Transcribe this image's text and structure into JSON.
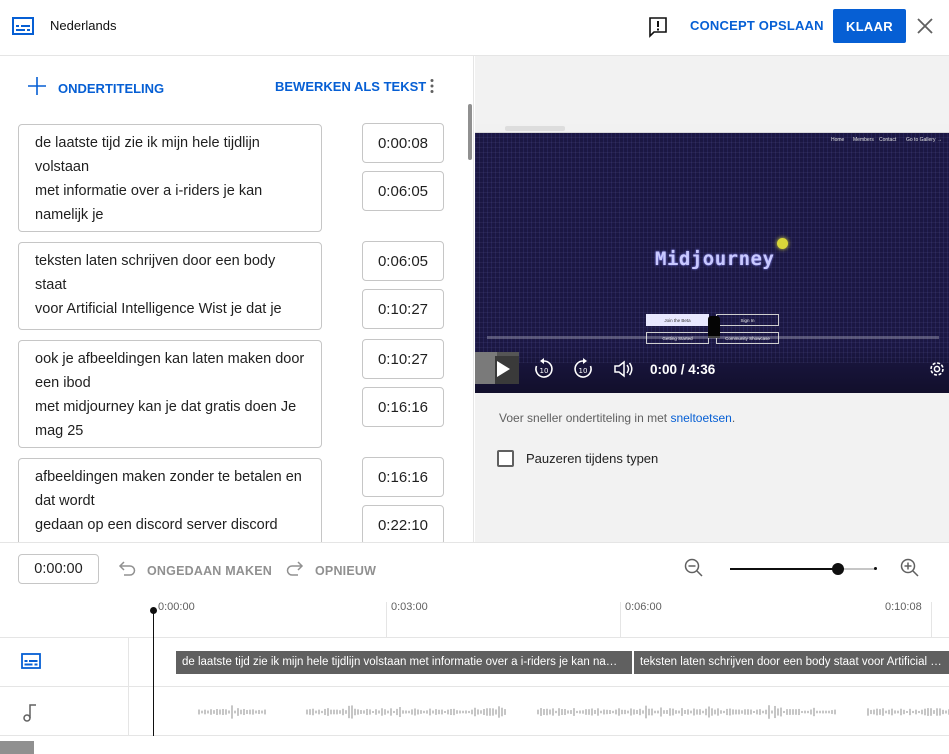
{
  "header": {
    "language": "Nederlands",
    "save_draft_label": "CONCEPT OPSLAAN",
    "done_label": "KLAAR"
  },
  "editor": {
    "add_subtitle_label": "ONDERTITELING",
    "edit_as_text_label": "BEWERKEN ALS TEKST",
    "cues": [
      {
        "text": "de laatste tijd zie ik mijn hele tijdlijn volstaan\nmet informatie over a i-riders je kan namelijk je",
        "start": "0:00:08",
        "end": "0:06:05"
      },
      {
        "text": "teksten laten schrijven door een body staat\nvoor Artificial Intelligence Wist je dat je",
        "start": "0:06:05",
        "end": "0:10:27"
      },
      {
        "text": "ook je afbeeldingen kan laten maken door een ibod\nmet midjourney kan je dat gratis doen Je mag 25",
        "start": "0:10:27",
        "end": "0:16:16"
      },
      {
        "text": "afbeeldingen maken zonder te betalen en dat wordt\ngedaan op een discord server discord",
        "start": "0:16:16",
        "end": "0:22:10"
      }
    ]
  },
  "video": {
    "brand_text": "Midjourney",
    "nav_items": [
      "Home",
      "Members",
      "Contact",
      "Go to Gallery →"
    ],
    "page_buttons": [
      "Join the Beta",
      "Sign In",
      "Getting Started",
      "Community Showcase"
    ],
    "time_readout": "0:00 / 4:36",
    "colors": {
      "background": "#1b1743",
      "accent": "#d8d63a"
    }
  },
  "side": {
    "hint_prefix": "Voer sneller ondertiteling in met ",
    "hint_link": "sneltoetsen",
    "hint_suffix": ".",
    "pause_label": "Pauzeren tijdens typen",
    "pause_checked": false
  },
  "toolbar": {
    "current_time": "0:00:00",
    "undo_label": "ONGEDAAN MAKEN",
    "redo_label": "OPNIEUW",
    "zoom_level": 0.74
  },
  "timeline": {
    "ticks": [
      "0:00:00",
      "0:03:00",
      "0:06:00",
      "0:10:08"
    ],
    "segments": [
      "de laatste tijd zie ik mijn hele tijdlijn volstaan  met informatie over a i-riders je kan namelijk je",
      "teksten laten schrijven door een body staat  voor Artificial Intelligence Wist je dat je"
    ]
  },
  "colors": {
    "accent": "#065fd4",
    "text": "#0f0f0f",
    "muted": "#606060"
  }
}
